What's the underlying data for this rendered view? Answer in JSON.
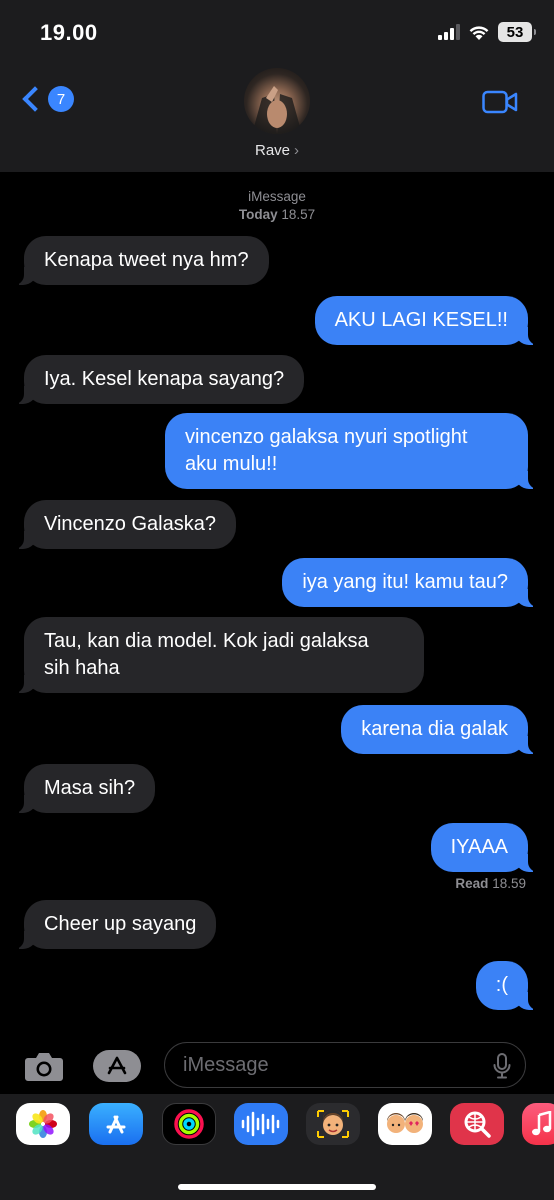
{
  "status_bar": {
    "time": "19.00",
    "battery": "53"
  },
  "header": {
    "back_badge": "7",
    "contact_name": "Rave",
    "contact_chevron": "›"
  },
  "conversation": {
    "service": "iMessage",
    "date_label": "Today",
    "time_label": "18.57",
    "messages": [
      {
        "from": "them",
        "text": "Kenapa tweet nya hm?"
      },
      {
        "from": "me",
        "text": "AKU LAGI KESEL!!"
      },
      {
        "from": "them",
        "text": "Iya. Kesel kenapa sayang?"
      },
      {
        "from": "me",
        "line1": "vincenzo galaksa nyuri spotlight",
        "line2": "aku mulu!!"
      },
      {
        "from": "them",
        "text": "Vincenzo Galaska?"
      },
      {
        "from": "me",
        "text": "iya yang itu! kamu tau?"
      },
      {
        "from": "them",
        "line1": "Tau, kan dia model. Kok jadi galaksa",
        "line2": "sih haha"
      },
      {
        "from": "me",
        "text": "karena dia galak"
      },
      {
        "from": "them",
        "text": "Masa sih?"
      },
      {
        "from": "me",
        "text": "IYAAA"
      },
      {
        "from": "them",
        "text": "Cheer up sayang"
      },
      {
        "from": "me",
        "text": ":("
      }
    ],
    "receipt": {
      "label": "Read",
      "time": "18.59"
    }
  },
  "composer": {
    "placeholder": "iMessage"
  },
  "icons": [
    "chevron-left-icon",
    "video-camera-icon",
    "camera-icon",
    "app-store-icon",
    "microphone-icon"
  ],
  "app_drawer": [
    "photos",
    "app-store",
    "activity",
    "audio-message",
    "memoji",
    "memoji-stickers",
    "search-images",
    "music"
  ],
  "colors": {
    "outgoing": "#3b82f6",
    "incoming": "#262629",
    "accent": "#3a86ff",
    "background": "#000000",
    "bar": "#1c1c1e"
  }
}
